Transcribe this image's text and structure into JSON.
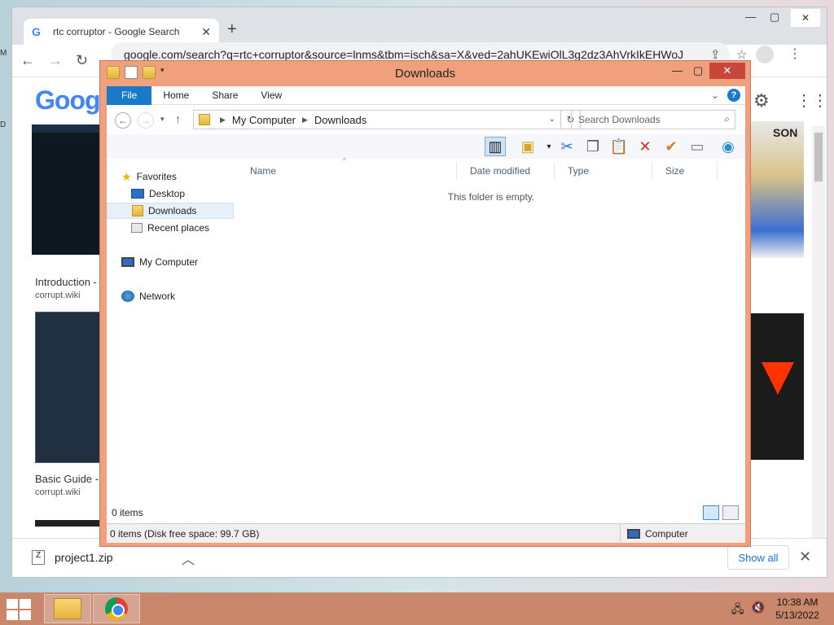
{
  "chrome": {
    "tab_title": "rtc corruptor - Google Search",
    "url": "google.com/search?q=rtc+corruptor&source=lnms&tbm=isch&sa=X&ved=2ahUKEwiOlL3g2dz3AhVrkIkEHWoJ",
    "logo": "Google",
    "results": [
      {
        "title": "Introduction - C",
        "url": "corrupt.wiki"
      },
      {
        "title": "Basic Guide - C",
        "url": "corrupt.wiki"
      }
    ],
    "sony_text": "SON",
    "download": {
      "filename": "project1.zip",
      "show_all": "Show all"
    }
  },
  "explorer": {
    "title": "Downloads",
    "ribbon_tabs": [
      "File",
      "Home",
      "Share",
      "View"
    ],
    "breadcrumb": [
      "My Computer",
      "Downloads"
    ],
    "search_placeholder": "Search Downloads",
    "nav": {
      "favorites": "Favorites",
      "desktop": "Desktop",
      "downloads": "Downloads",
      "recent": "Recent places",
      "computer": "My Computer",
      "network": "Network"
    },
    "columns": [
      "Name",
      "Date modified",
      "Type",
      "Size"
    ],
    "empty_message": "This folder is empty.",
    "item_count": "0 items",
    "details": "0 items (Disk free space: 99.7 GB)",
    "details_right": "Computer"
  },
  "taskbar": {
    "time": "10:38 AM",
    "date": "5/13/2022"
  },
  "colors": {
    "explorer_frame": "#f0a07c",
    "taskbar": "#c9876c",
    "file_tab": "#1979ca",
    "close_red": "#c8463a"
  }
}
